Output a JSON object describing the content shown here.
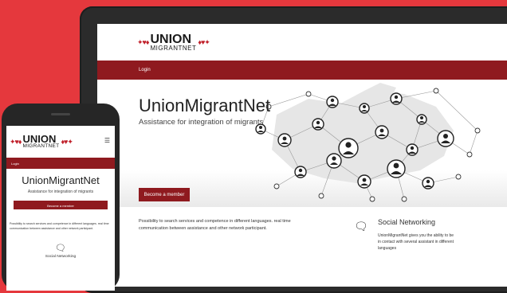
{
  "brand": {
    "name_line1": "UNION",
    "name_line2": "MIGRANTNET"
  },
  "nav": {
    "login_label": "Login"
  },
  "hero": {
    "title": "UnionMigrantNet",
    "subtitle": "Assistance for integration of migrants",
    "cta_label": "Become a member"
  },
  "info": {
    "description": "Possibility to search services and competence in different languages. real time communication between assistance and other network participant."
  },
  "social": {
    "title": "Social Networking",
    "description": "UnionMigrantNet gives you the ability to be in contact with several assistant in different languages",
    "icon": "chat-bubble-icon"
  },
  "colors": {
    "background": "#e5383d",
    "brand_red": "#8f1a1f",
    "device": "#2b2b2b"
  }
}
